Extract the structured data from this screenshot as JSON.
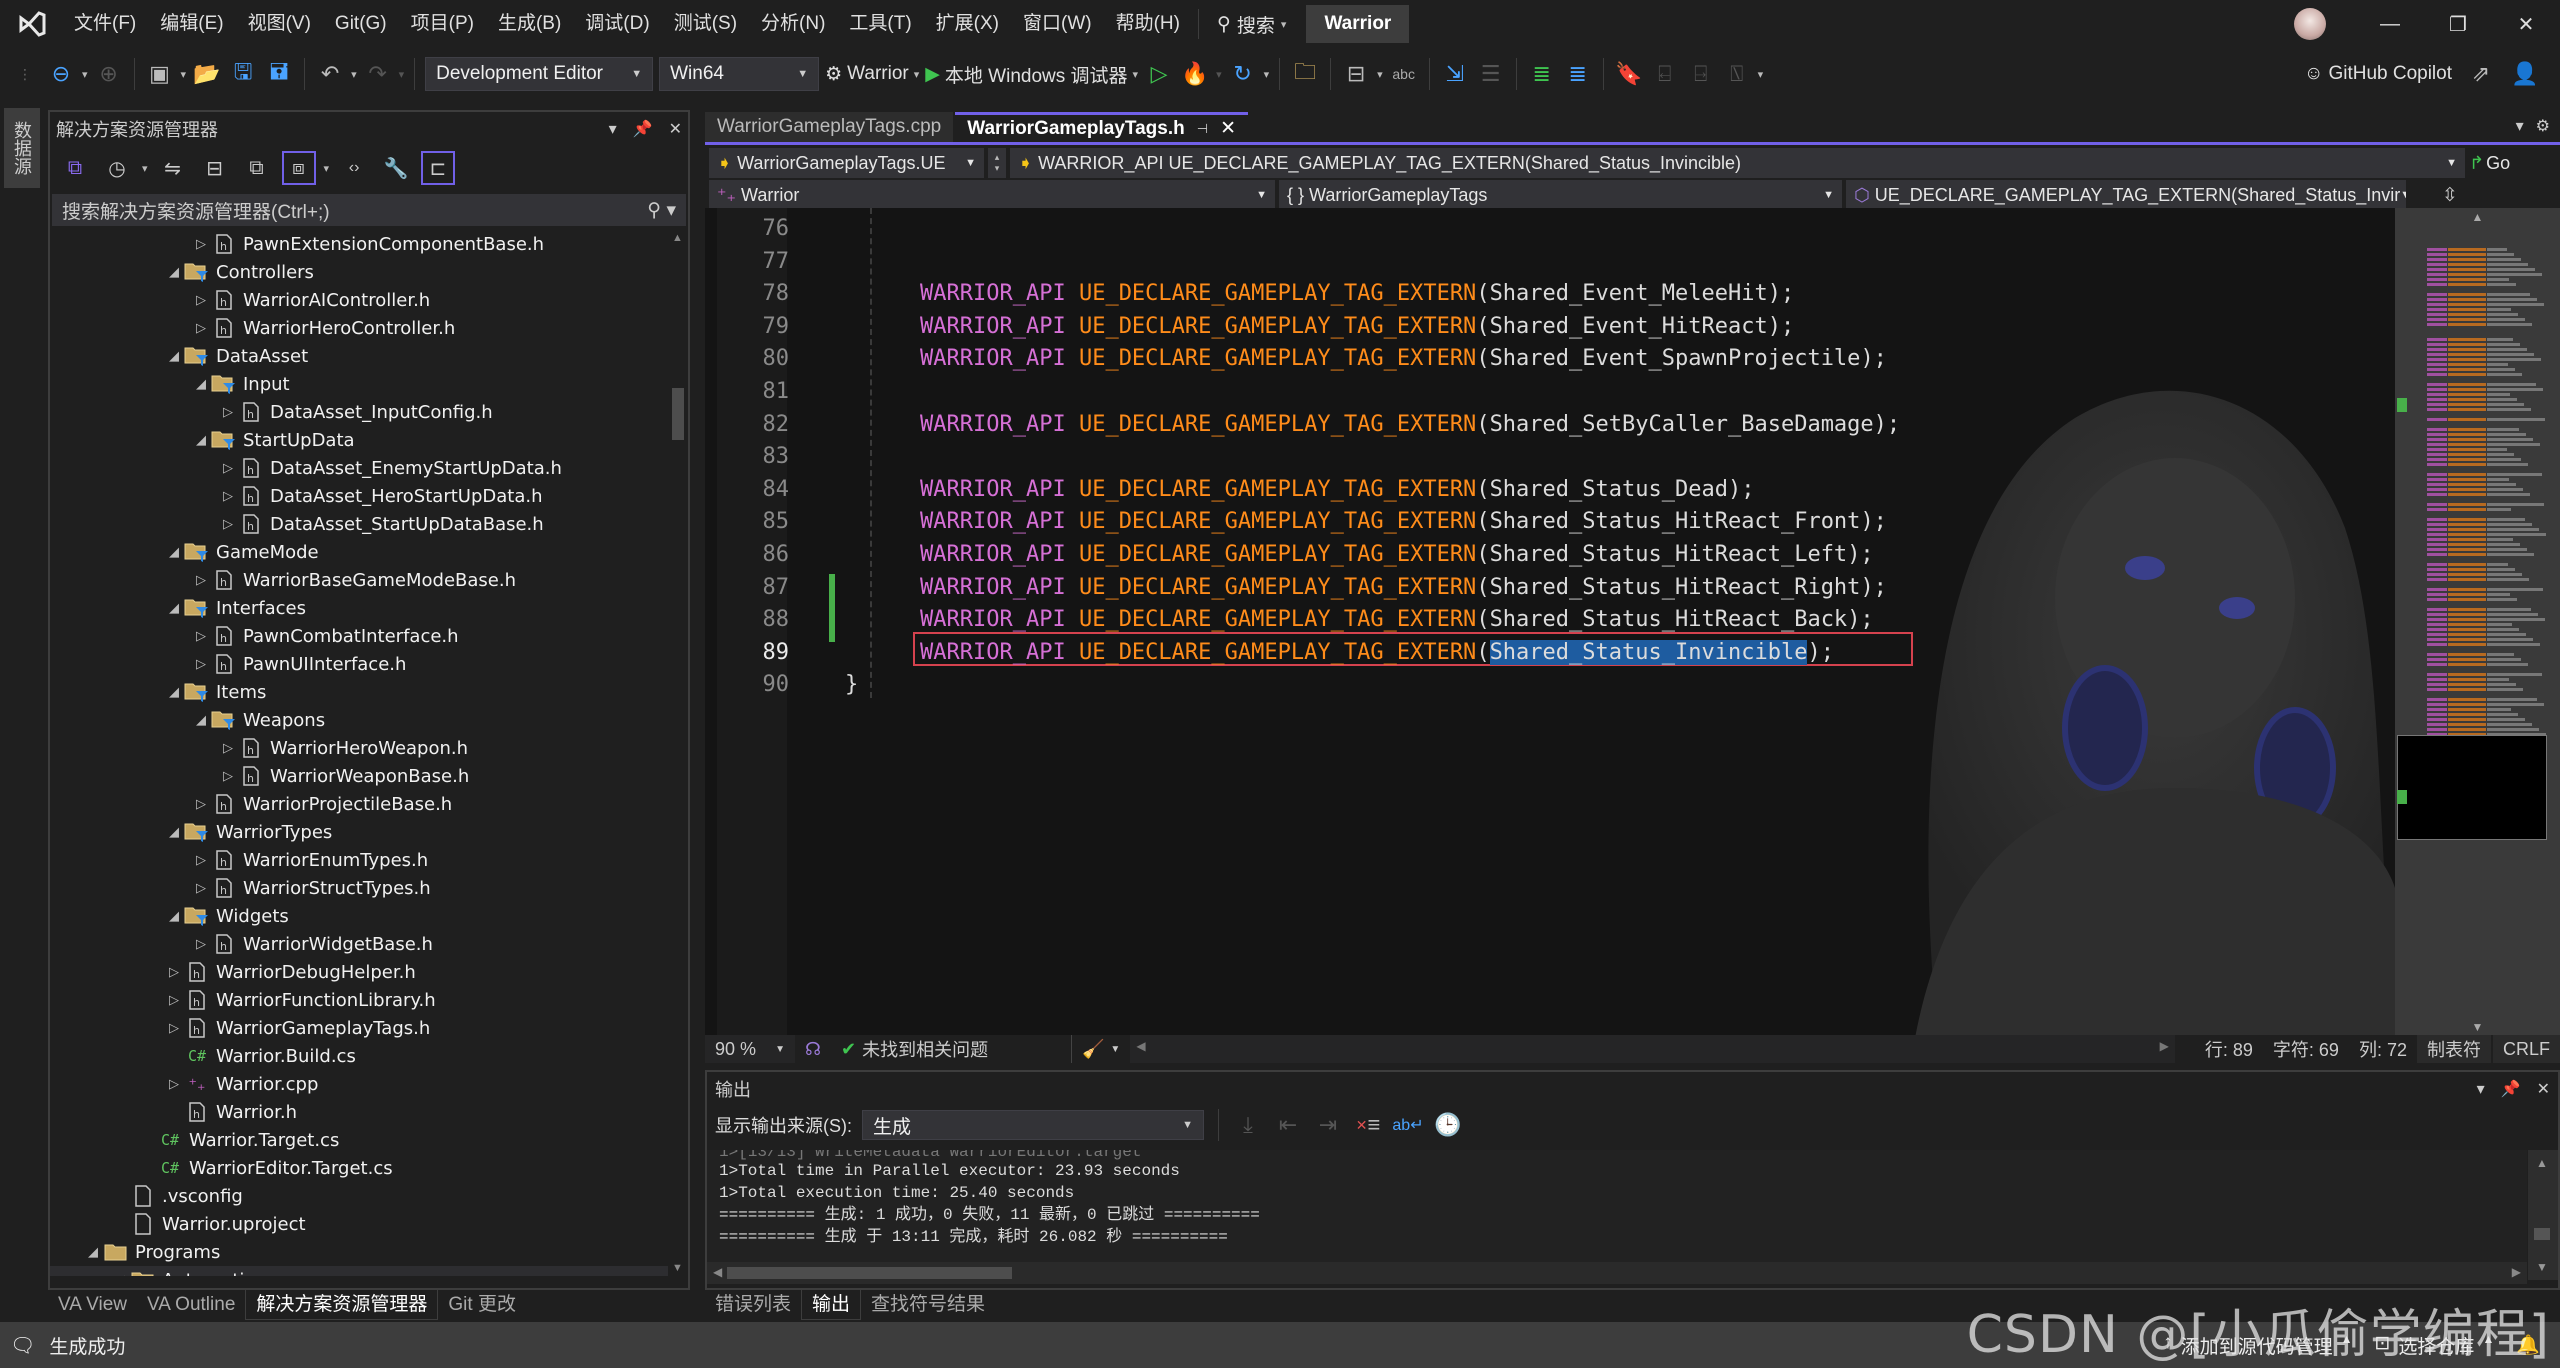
{
  "titlebar": {
    "menu": [
      "文件(F)",
      "编辑(E)",
      "视图(V)",
      "Git(G)",
      "项目(P)",
      "生成(B)",
      "调试(D)",
      "测试(S)",
      "分析(N)",
      "工具(T)",
      "扩展(X)",
      "窗口(W)",
      "帮助(H)"
    ],
    "search_label": "搜索",
    "solution_name": "Warrior",
    "minimize": "—",
    "restore": "❐",
    "close": "✕"
  },
  "toolbar": {
    "configuration": "Development Editor",
    "platform": "Win64",
    "startup_project": "Warrior",
    "debugger": "本地 Windows 调试器",
    "copilot": "GitHub Copilot"
  },
  "left_strip": {
    "datasource_tab": "数据源"
  },
  "solution_explorer": {
    "title": "解决方案资源管理器",
    "search_placeholder": "搜索解决方案资源管理器(Ctrl+;)",
    "tree": [
      {
        "label": "PawnExtensionComponentBase.h",
        "type": "h",
        "depth": 3,
        "twisty": "collapsed"
      },
      {
        "label": "Controllers",
        "type": "filter",
        "depth": 2,
        "twisty": "expanded"
      },
      {
        "label": "WarriorAIController.h",
        "type": "h",
        "depth": 3,
        "twisty": "collapsed"
      },
      {
        "label": "WarriorHeroController.h",
        "type": "h",
        "depth": 3,
        "twisty": "collapsed"
      },
      {
        "label": "DataAsset",
        "type": "filter",
        "depth": 2,
        "twisty": "expanded"
      },
      {
        "label": "Input",
        "type": "filter",
        "depth": 3,
        "twisty": "expanded"
      },
      {
        "label": "DataAsset_InputConfig.h",
        "type": "h",
        "depth": 4,
        "twisty": "collapsed"
      },
      {
        "label": "StartUpData",
        "type": "filter",
        "depth": 3,
        "twisty": "expanded"
      },
      {
        "label": "DataAsset_EnemyStartUpData.h",
        "type": "h",
        "depth": 4,
        "twisty": "collapsed"
      },
      {
        "label": "DataAsset_HeroStartUpData.h",
        "type": "h",
        "depth": 4,
        "twisty": "collapsed"
      },
      {
        "label": "DataAsset_StartUpDataBase.h",
        "type": "h",
        "depth": 4,
        "twisty": "collapsed"
      },
      {
        "label": "GameMode",
        "type": "filter",
        "depth": 2,
        "twisty": "expanded"
      },
      {
        "label": "WarriorBaseGameModeBase.h",
        "type": "h",
        "depth": 3,
        "twisty": "collapsed"
      },
      {
        "label": "Interfaces",
        "type": "filter",
        "depth": 2,
        "twisty": "expanded"
      },
      {
        "label": "PawnCombatInterface.h",
        "type": "h",
        "depth": 3,
        "twisty": "collapsed"
      },
      {
        "label": "PawnUIInterface.h",
        "type": "h",
        "depth": 3,
        "twisty": "collapsed"
      },
      {
        "label": "Items",
        "type": "filter",
        "depth": 2,
        "twisty": "expanded"
      },
      {
        "label": "Weapons",
        "type": "filter",
        "depth": 3,
        "twisty": "expanded"
      },
      {
        "label": "WarriorHeroWeapon.h",
        "type": "h",
        "depth": 4,
        "twisty": "collapsed"
      },
      {
        "label": "WarriorWeaponBase.h",
        "type": "h",
        "depth": 4,
        "twisty": "collapsed"
      },
      {
        "label": "WarriorProjectileBase.h",
        "type": "h",
        "depth": 3,
        "twisty": "collapsed"
      },
      {
        "label": "WarriorTypes",
        "type": "filter",
        "depth": 2,
        "twisty": "expanded"
      },
      {
        "label": "WarriorEnumTypes.h",
        "type": "h",
        "depth": 3,
        "twisty": "collapsed"
      },
      {
        "label": "WarriorStructTypes.h",
        "type": "h",
        "depth": 3,
        "twisty": "collapsed"
      },
      {
        "label": "Widgets",
        "type": "filter",
        "depth": 2,
        "twisty": "expanded"
      },
      {
        "label": "WarriorWidgetBase.h",
        "type": "h",
        "depth": 3,
        "twisty": "collapsed"
      },
      {
        "label": "WarriorDebugHelper.h",
        "type": "h",
        "depth": 2,
        "twisty": "collapsed"
      },
      {
        "label": "WarriorFunctionLibrary.h",
        "type": "h",
        "depth": 2,
        "twisty": "collapsed"
      },
      {
        "label": "WarriorGameplayTags.h",
        "type": "h",
        "depth": 2,
        "twisty": "collapsed"
      },
      {
        "label": "Warrior.Build.cs",
        "type": "cs",
        "depth": 2,
        "twisty": "none"
      },
      {
        "label": "Warrior.cpp",
        "type": "cpp",
        "depth": 2,
        "twisty": "collapsed"
      },
      {
        "label": "Warrior.h",
        "type": "h",
        "depth": 2,
        "twisty": "none"
      },
      {
        "label": "Warrior.Target.cs",
        "type": "cs",
        "depth": 1,
        "twisty": "none"
      },
      {
        "label": "WarriorEditor.Target.cs",
        "type": "cs",
        "depth": 1,
        "twisty": "none"
      },
      {
        "label": ".vsconfig",
        "type": "file",
        "depth": 0,
        "twisty": "none"
      },
      {
        "label": "Warrior.uproject",
        "type": "file",
        "depth": 0,
        "twisty": "none"
      },
      {
        "label": "Programs",
        "type": "folder",
        "depth": -1,
        "twisty": "expanded"
      },
      {
        "label": "Automation",
        "type": "folder",
        "depth": 0,
        "twisty": "expanded",
        "selected": true
      }
    ],
    "bottom_tabs": [
      "VA View",
      "VA Outline",
      "解决方案资源管理器",
      "Git 更改"
    ],
    "active_bottom_tab": 2
  },
  "editor": {
    "tabs": [
      {
        "label": "WarriorGameplayTags.cpp",
        "active": false
      },
      {
        "label": "WarriorGameplayTags.h",
        "active": true
      }
    ],
    "nav": {
      "scope": "WarriorGameplayTags.UE",
      "member": "WARRIOR_API UE_DECLARE_GAMEPLAY_TAG_EXTERN(Shared_Status_Invincible)",
      "go_label": "Go",
      "project": "Warrior",
      "namespace": "{ } WarriorGameplayTags",
      "symbol": "UE_DECLARE_GAMEPLAY_TAG_EXTERN(Shared_Status_Invir"
    },
    "lines": [
      {
        "num": "76",
        "api": "",
        "macro": "",
        "arg": "",
        "tail": ""
      },
      {
        "num": "77",
        "api": "",
        "macro": "",
        "arg": "",
        "tail": ""
      },
      {
        "num": "78",
        "api": "WARRIOR_API",
        "macro": "UE_DECLARE_GAMEPLAY_TAG_EXTERN",
        "arg": "Shared_Event_MeleeHit",
        "tail": ");"
      },
      {
        "num": "79",
        "api": "WARRIOR_API",
        "macro": "UE_DECLARE_GAMEPLAY_TAG_EXTERN",
        "arg": "Shared_Event_HitReact",
        "tail": ");"
      },
      {
        "num": "80",
        "api": "WARRIOR_API",
        "macro": "UE_DECLARE_GAMEPLAY_TAG_EXTERN",
        "arg": "Shared_Event_SpawnProjectile",
        "tail": ");"
      },
      {
        "num": "81",
        "api": "",
        "macro": "",
        "arg": "",
        "tail": ""
      },
      {
        "num": "82",
        "api": "WARRIOR_API",
        "macro": "UE_DECLARE_GAMEPLAY_TAG_EXTERN",
        "arg": "Shared_SetByCaller_BaseDamage",
        "tail": ");"
      },
      {
        "num": "83",
        "api": "",
        "macro": "",
        "arg": "",
        "tail": ""
      },
      {
        "num": "84",
        "api": "WARRIOR_API",
        "macro": "UE_DECLARE_GAMEPLAY_TAG_EXTERN",
        "arg": "Shared_Status_Dead",
        "tail": ");"
      },
      {
        "num": "85",
        "api": "WARRIOR_API",
        "macro": "UE_DECLARE_GAMEPLAY_TAG_EXTERN",
        "arg": "Shared_Status_HitReact_Front",
        "tail": ");"
      },
      {
        "num": "86",
        "api": "WARRIOR_API",
        "macro": "UE_DECLARE_GAMEPLAY_TAG_EXTERN",
        "arg": "Shared_Status_HitReact_Left",
        "tail": ");"
      },
      {
        "num": "87",
        "api": "WARRIOR_API",
        "macro": "UE_DECLARE_GAMEPLAY_TAG_EXTERN",
        "arg": "Shared_Status_HitReact_Right",
        "tail": ");"
      },
      {
        "num": "88",
        "api": "WARRIOR_API",
        "macro": "UE_DECLARE_GAMEPLAY_TAG_EXTERN",
        "arg": "Shared_Status_HitReact_Back",
        "tail": ");"
      },
      {
        "num": "89",
        "api": "WARRIOR_API",
        "macro": "UE_DECLARE_GAMEPLAY_TAG_EXTERN",
        "arg": "Shared_Status_Invincible",
        "tail": ");",
        "current": true,
        "selected_arg": true
      },
      {
        "num": "90",
        "api": "",
        "macro": "",
        "arg": "",
        "tail": "}",
        "brace": true
      }
    ],
    "status": {
      "zoom": "90 %",
      "issues": "未找到相关问题",
      "line": "行: 89",
      "char": "字符: 69",
      "col": "列: 72",
      "indent": "制表符",
      "eol": "CRLF"
    }
  },
  "output": {
    "title": "输出",
    "source_label": "显示输出来源(S):",
    "source_value": "生成",
    "lines": [
      "1>Total time in Parallel executor: 23.93 seconds",
      "1>Total execution time: 25.40 seconds",
      "========== 生成: 1 成功，0 失败，11 最新，0 已跳过 ==========",
      "========== 生成 于 13:11 完成，耗时 26.082 秒 =========="
    ],
    "tabs": [
      "错误列表",
      "输出",
      "查找符号结果"
    ],
    "active_tab": 1
  },
  "statusbar": {
    "message": "生成成功",
    "add_source_control": "添加到源代码管理",
    "select_repo": "选择仓库"
  },
  "watermark": "CSDN @[小瓜偷学编程]",
  "colors": {
    "accent": "#7160e8",
    "api_macro": "#d670d6",
    "ue_macro": "#ff8c1a",
    "selection": "#1e5ca0",
    "modified_bar": "#48b04a",
    "current_line_border": "#d5424e"
  }
}
